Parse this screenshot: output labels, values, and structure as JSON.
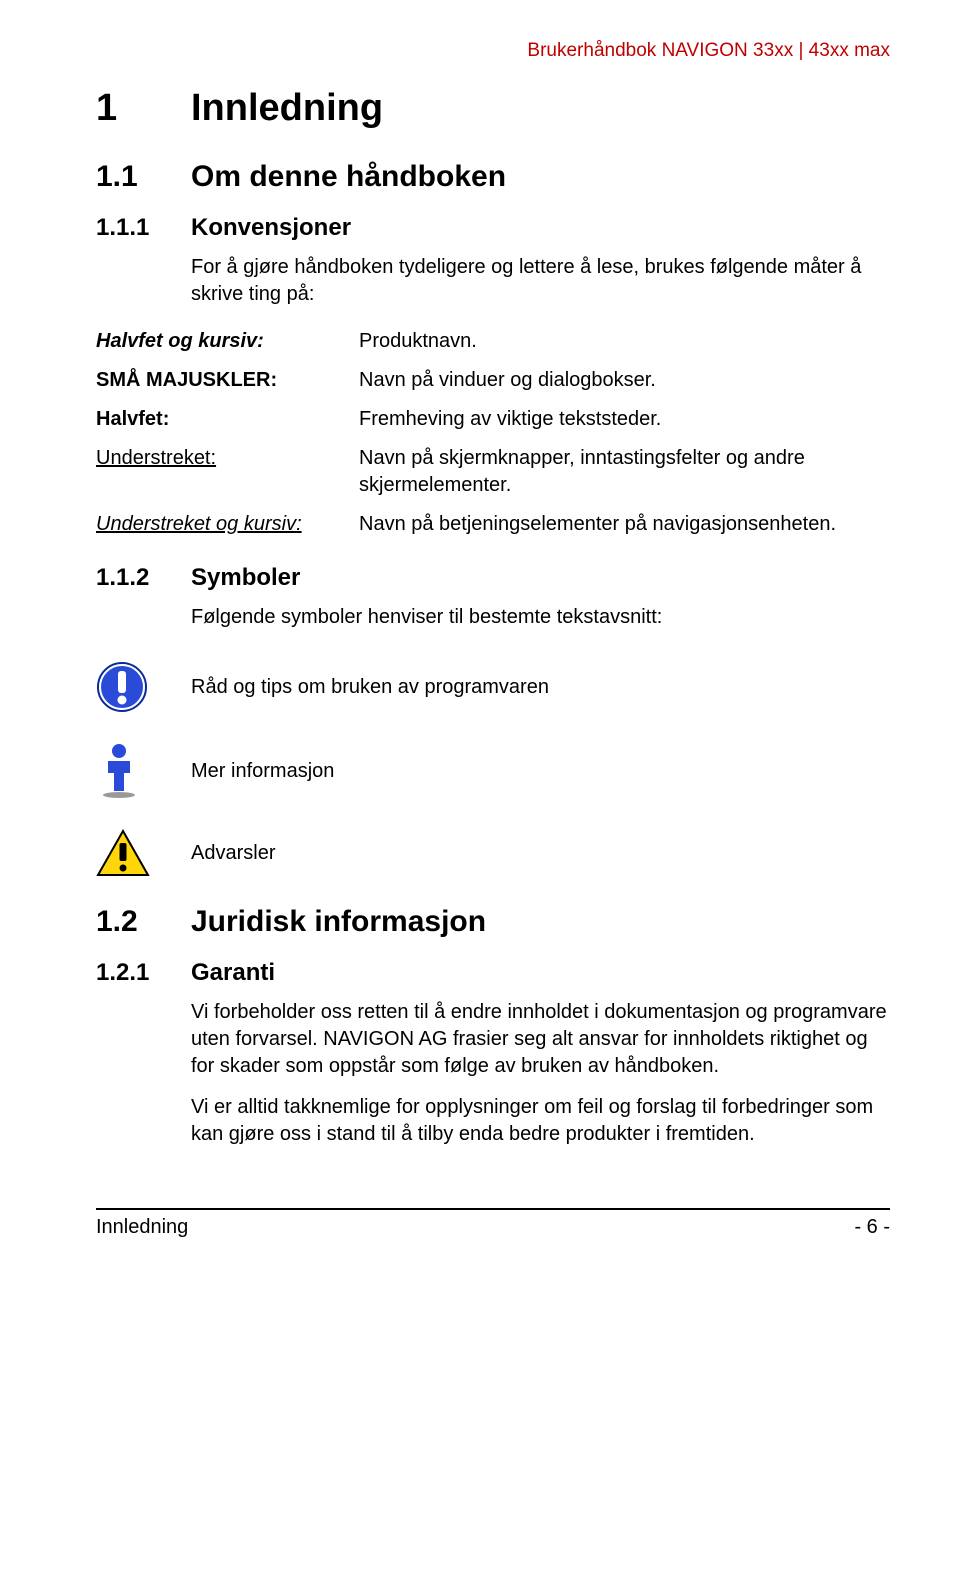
{
  "running_header": "Brukerhåndbok NAVIGON 33xx | 43xx max",
  "h1": {
    "num": "1",
    "title": "Innledning"
  },
  "s11": {
    "num": "1.1",
    "title": "Om denne håndboken"
  },
  "s111": {
    "num": "1.1.1",
    "title": "Konvensjoner",
    "intro": "For å gjøre håndboken tydeligere og lettere å lese, brukes følgende måter å skrive ting på:"
  },
  "conv": {
    "r0": {
      "left": "Halvfet og kursiv:",
      "right": "Produktnavn."
    },
    "r1": {
      "left": "SMÅ MAJUSKLER:",
      "right": "Navn på vinduer og dialogbokser."
    },
    "r2": {
      "left": "Halvfet:",
      "right": "Fremheving av viktige tekststeder."
    },
    "r3": {
      "left": "Understreket:",
      "right": "Navn på skjermknapper, inntastingsfelter og andre skjermelementer."
    },
    "r4": {
      "left": "Understreket og kursiv:",
      "right": "Navn på betjeningselementer på navigasjonsenheten."
    }
  },
  "s112": {
    "num": "1.1.2",
    "title": "Symboler",
    "intro": "Følgende symboler henviser til bestemte tekstavsnitt:"
  },
  "symbols": {
    "tip": "Råd og tips om bruken av programvaren",
    "info": "Mer informasjon",
    "warn": "Advarsler"
  },
  "s12": {
    "num": "1.2",
    "title": "Juridisk informasjon"
  },
  "s121": {
    "num": "1.2.1",
    "title": "Garanti",
    "p1": "Vi forbeholder oss retten til å endre innholdet i dokumentasjon og programvare uten forvarsel. NAVIGON AG frasier seg alt ansvar for innholdets riktighet og for skader som oppstår som følge av bruken av håndboken.",
    "p2": "Vi er alltid takknemlige for opplysninger om feil og forslag til forbedringer som kan gjøre oss i stand til å tilby enda bedre produkter i fremtiden."
  },
  "footer": {
    "left": "Innledning",
    "right": "- 6 -"
  }
}
